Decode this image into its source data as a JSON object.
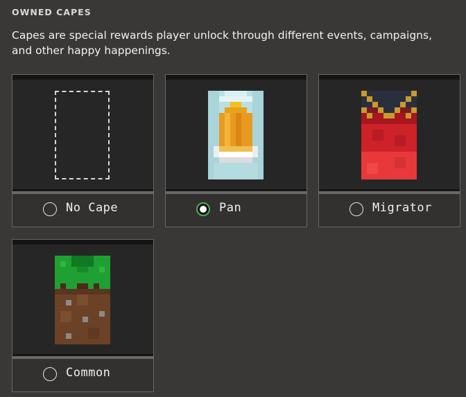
{
  "section": {
    "title": "OWNED CAPES",
    "description": "Capes are special rewards player unlock through different events, campaigns, and other happy happenings."
  },
  "capes": [
    {
      "label": "No Cape",
      "selected": false,
      "icon": "empty-slot-icon"
    },
    {
      "label": "Pan",
      "selected": true,
      "icon": "pan-cape-icon"
    },
    {
      "label": "Migrator",
      "selected": false,
      "icon": "migrator-cape-icon"
    },
    {
      "label": "Common",
      "selected": false,
      "icon": "common-cape-icon"
    }
  ],
  "colors": {
    "background": "#3a3836",
    "card_border": "#6a6866",
    "selected_accent": "#4caf50"
  }
}
